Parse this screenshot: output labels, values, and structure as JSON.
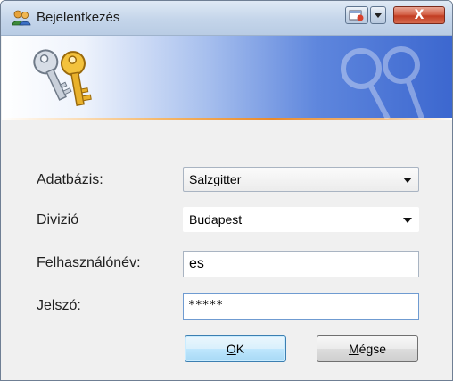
{
  "window": {
    "title": "Bejelentkezés",
    "accent": "#3c67cf",
    "close_label": "X"
  },
  "form": {
    "database_label": "Adatbázis:",
    "database_value": "Salzgitter",
    "division_label": "Divizió",
    "division_value": "Budapest",
    "username_label": "Felhasználónév:",
    "username_value": "es",
    "password_label": "Jelszó:",
    "password_value": "*****"
  },
  "buttons": {
    "ok_mnemonic": "O",
    "ok_rest": "K",
    "cancel_mnemonic": "M",
    "cancel_rest": "égse"
  },
  "icons": {
    "title": "users-icon",
    "banner": "keys-icon",
    "watermark": "keys-watermark-icon"
  }
}
